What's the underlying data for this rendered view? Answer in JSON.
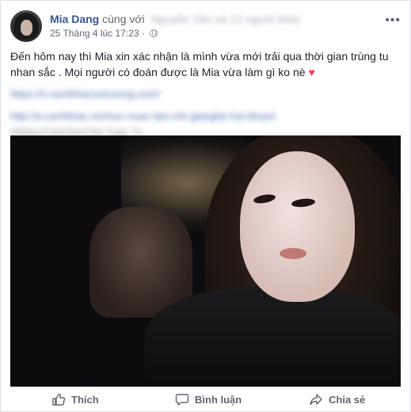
{
  "post": {
    "author": "Mia Dang",
    "with_label": "cùng với",
    "with_blurred": "Nguyễn Văn và 12 người khác",
    "timestamp": "25 Tháng 4 lúc 17:23 ·",
    "text_line1": "Đến hôm nay thì Mia xin xác nhận là mình vừa mới trải qua thời gian trùng tu",
    "text_line2": "nhan sắc . Mọi người có đoán được là Mia vừa làm gì ko nè",
    "heart": "♥",
    "blurred_line1": "https://s.cachkhacxemxong.com/",
    "blurred_line2": "http://a.cachkhac.vn/moc-nuac-lam-nhi-gianghe-hoi-khuen",
    "blurred_line3": "#NhieuTrinhTamThe Tuan Tu"
  },
  "actions": {
    "like_label": "Thích",
    "comment_label": "Bình luận",
    "share_label": "Chia sẻ"
  },
  "icons": {
    "more": "•••"
  }
}
